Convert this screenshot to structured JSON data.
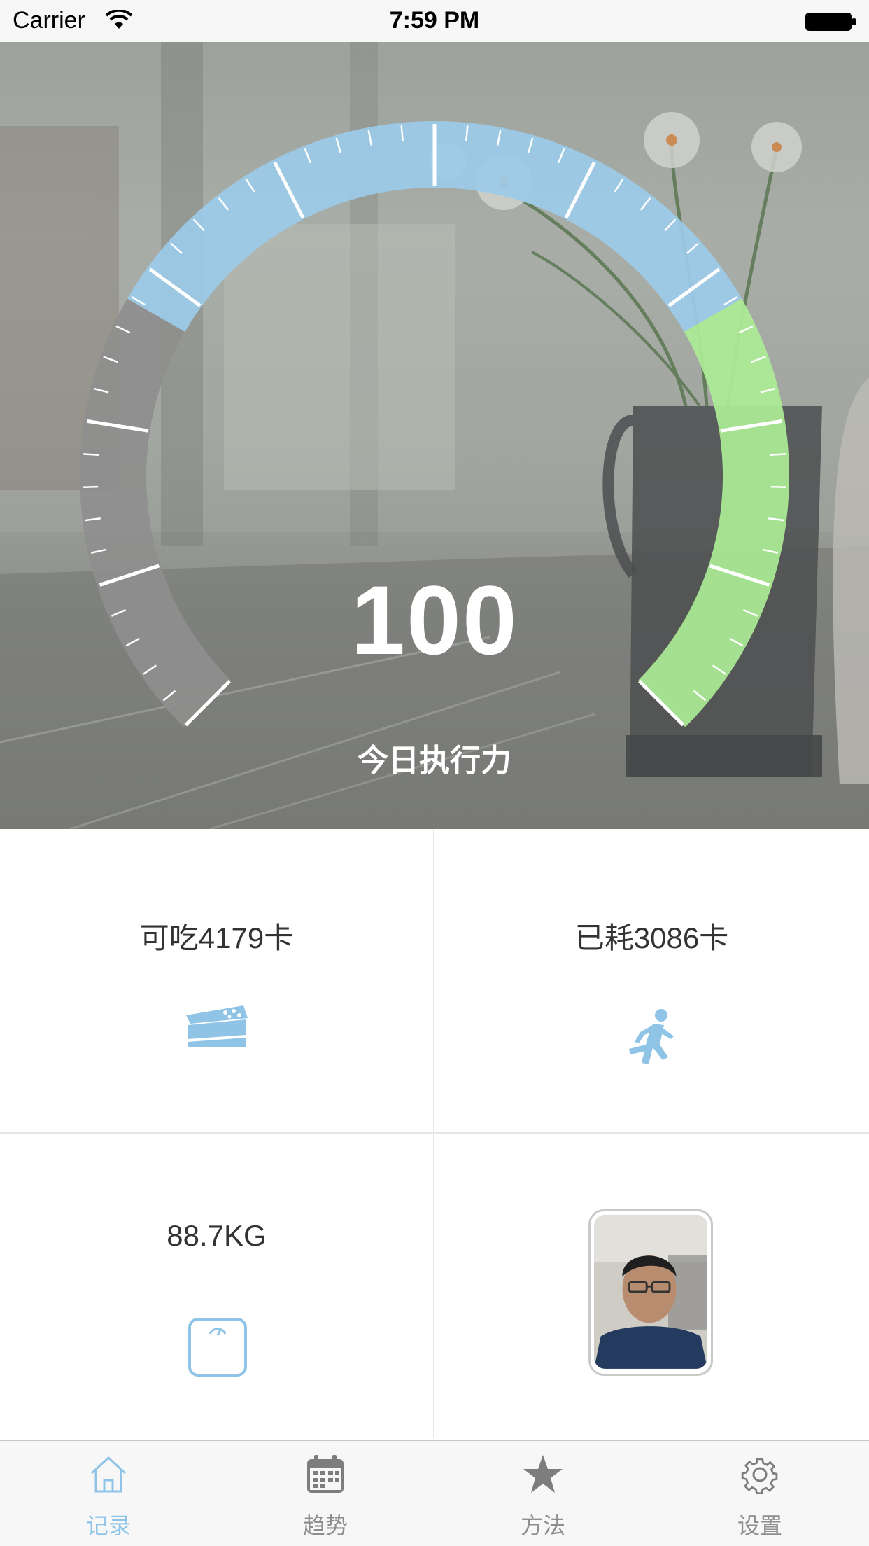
{
  "status_bar": {
    "carrier": "Carrier",
    "time": "7:59 PM"
  },
  "gauge": {
    "score": "100",
    "label": "今日执行力",
    "colors": {
      "low": "#8e8e8e",
      "mid": "#9ccbe9",
      "high": "#acec96",
      "needle": "#ffffff"
    }
  },
  "cards": {
    "calories_allowed": {
      "text": "可吃4179卡",
      "icon": "cake-icon"
    },
    "calories_burned": {
      "text": "已耗3086卡",
      "icon": "running-person-icon"
    },
    "weight": {
      "text": "88.7KG",
      "icon": "scale-icon"
    },
    "photo": {
      "icon": "user-photo"
    }
  },
  "tabs": [
    {
      "label": "记录",
      "icon": "home-icon",
      "active": true
    },
    {
      "label": "趋势",
      "icon": "calendar-icon",
      "active": false
    },
    {
      "label": "方法",
      "icon": "star-icon",
      "active": false
    },
    {
      "label": "设置",
      "icon": "gear-icon",
      "active": false
    }
  ],
  "accent_color": "#8fc4e6"
}
